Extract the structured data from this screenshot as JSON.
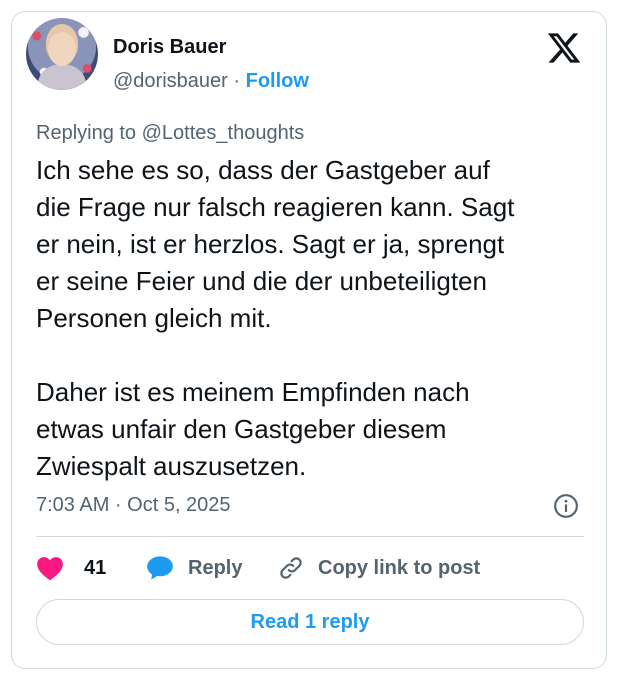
{
  "author": {
    "name": "Doris Bauer",
    "handle": "@dorisbauer",
    "separator": "·",
    "follow_label": "Follow"
  },
  "replying_to": "Replying to @Lottes_thoughts",
  "post": {
    "text": "Ich sehe es so, dass der Gastgeber auf\ndie Frage nur falsch reagieren kann. Sagt\ner nein, ist er herzlos. Sagt er ja, sprengt\ner seine Feier und die der unbeteiligten\nPersonen gleich mit.\n\nDaher ist es meinem Empfinden nach\netwas unfair den Gastgeber diesem\nZwiespalt auszusetzen.",
    "timestamp": "7:03 AM · Oct 5, 2025"
  },
  "actions": {
    "like_count": "41",
    "reply_label": "Reply",
    "copy_label": "Copy link to post"
  },
  "read_replies_label": "Read 1 reply",
  "icons": {
    "brand": "x-logo-icon",
    "info": "info-icon",
    "like": "heart-icon",
    "reply": "speech-bubble-icon",
    "copy": "link-icon"
  },
  "colors": {
    "accent": "#1d9bf0",
    "like": "#f91880",
    "muted": "#536471",
    "border": "#cfd9de"
  }
}
